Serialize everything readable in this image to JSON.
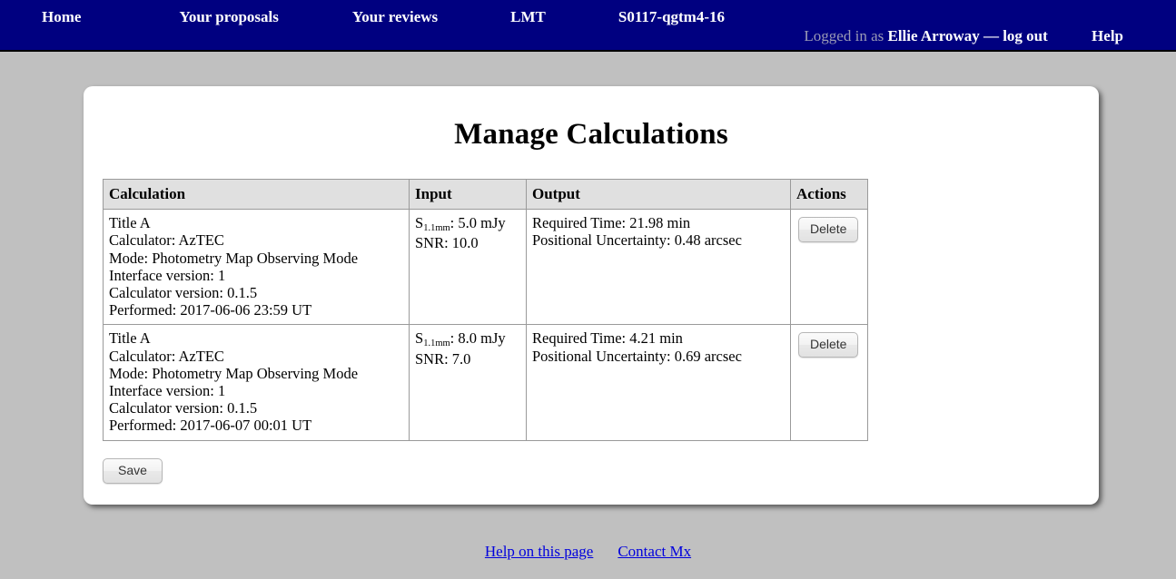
{
  "navbar": {
    "primary_links": [
      {
        "label": "Home"
      },
      {
        "label": "Your proposals"
      },
      {
        "label": "Your reviews"
      },
      {
        "label": "LMT"
      },
      {
        "label": "S0117-qgtm4-16"
      }
    ],
    "session": {
      "logged_in_label": "Logged in as",
      "user_name": "Ellie Arroway",
      "separator": "—",
      "logout_label": "log out"
    },
    "help_label": "Help",
    "background_color": "#000080",
    "text_color": "#ffffff",
    "muted_text_color": "#9a9ab5"
  },
  "page": {
    "title": "Manage Calculations",
    "background_color": "#c0c0c0",
    "panel_color": "#ffffff"
  },
  "table": {
    "headers": {
      "calculation": "Calculation",
      "input": "Input",
      "output": "Output",
      "actions": "Actions"
    },
    "rows": [
      {
        "calculation": {
          "title": "Title A",
          "calculator": "Calculator: AzTEC",
          "mode": "Mode: Photometry Map Observing Mode",
          "interface_version": "Interface version: 1",
          "calculator_version": "Calculator version: 0.1.5",
          "performed": "Performed: 2017-06-06 23:59 UT"
        },
        "input": {
          "flux_prefix": "S",
          "flux_subscript": "1.1mm",
          "flux_value": ": 5.0 mJy",
          "snr": "SNR: 10.0"
        },
        "output": {
          "required_time": "Required Time: 21.98 min",
          "positional_uncertainty": "Positional Uncertainty: 0.48 arcsec"
        },
        "action_label": "Delete"
      },
      {
        "calculation": {
          "title": "Title A",
          "calculator": "Calculator: AzTEC",
          "mode": "Mode: Photometry Map Observing Mode",
          "interface_version": "Interface version: 1",
          "calculator_version": "Calculator version: 0.1.5",
          "performed": "Performed: 2017-06-07 00:01 UT"
        },
        "input": {
          "flux_prefix": "S",
          "flux_subscript": "1.1mm",
          "flux_value": ": 8.0 mJy",
          "snr": "SNR: 7.0"
        },
        "output": {
          "required_time": "Required Time: 4.21 min",
          "positional_uncertainty": "Positional Uncertainty: 0.69 arcsec"
        },
        "action_label": "Delete"
      }
    ]
  },
  "save_label": "Save",
  "footer": {
    "links": [
      {
        "label": "Help on this page"
      },
      {
        "label": "Contact Mx"
      }
    ],
    "link_color": "#0000dd"
  }
}
